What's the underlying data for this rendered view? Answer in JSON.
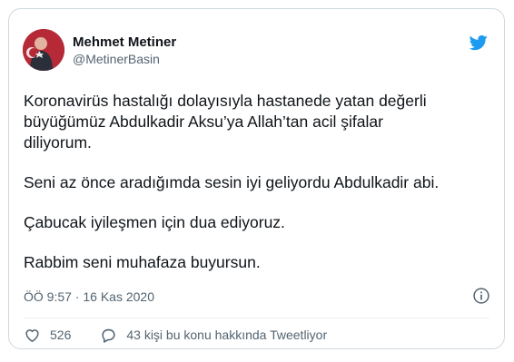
{
  "tweet": {
    "author": {
      "display_name": "Mehmet Metiner",
      "handle": "@MetinerBasin"
    },
    "paragraphs": [
      "Koronavirüs hastalığı dolayısıyla hastanede yatan değerli\nbüyüğümüz Abdulkadir Aksu’ya Allah’tan acil şifalar\ndiliyorum.",
      "Seni az önce aradığımda sesin iyi geliyordu Abdulkadir abi.",
      "Çabucak iyileşmen için dua ediyoruz.",
      "Rabbim seni muhafaza buyursun."
    ],
    "timestamp": "ÖÖ 9:57 · 16 Kas 2020",
    "like_count": "526",
    "reply_text": "43 kişi bu konu hakkında Tweetliyor"
  },
  "icons": {
    "logo": "twitter-bird-icon",
    "info": "info-icon",
    "like": "heart-icon",
    "reply": "speech-bubble-icon"
  },
  "colors": {
    "brand": "#1d9bf0",
    "secondary_text": "#536471",
    "border": "#cfd9de"
  }
}
